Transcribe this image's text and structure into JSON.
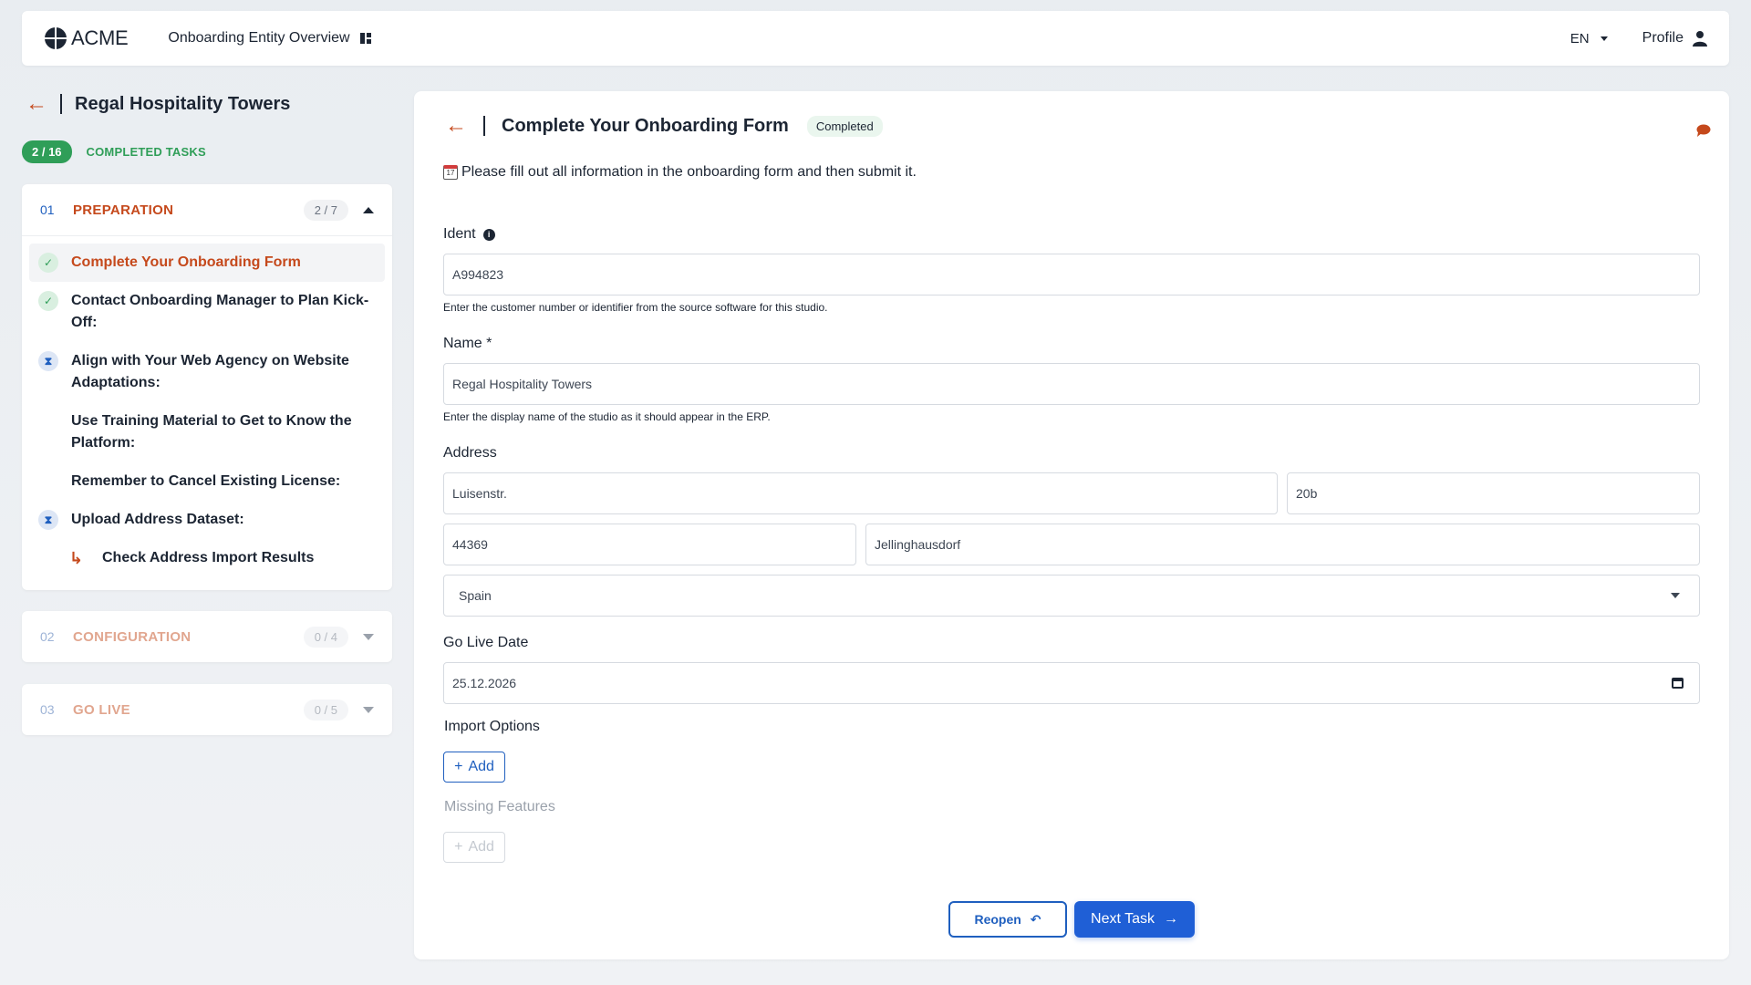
{
  "header": {
    "brand": "ACME",
    "nav_title": "Onboarding Entity Overview",
    "language": "EN",
    "profile_label": "Profile"
  },
  "entity": {
    "name": "Regal Hospitality Towers",
    "completed_count": "2 / 16",
    "completed_label": "COMPLETED TASKS"
  },
  "sections": [
    {
      "number": "01",
      "title": "PREPARATION",
      "count": "2 / 7",
      "tasks": [
        {
          "label": "Complete Your Onboarding Form",
          "status": "done"
        },
        {
          "label": "Contact Onboarding Manager to Plan Kick-Off:",
          "status": "done"
        },
        {
          "label": "Align with Your Web Agency on Website Adaptations:",
          "status": "waiting"
        },
        {
          "label": "Use Training Material to Get to Know the Platform:",
          "status": "none"
        },
        {
          "label": "Remember to Cancel Existing License:",
          "status": "none"
        },
        {
          "label": "Upload Address Dataset:",
          "status": "waiting"
        },
        {
          "label": "Check Address Import Results",
          "status": "sub"
        }
      ]
    },
    {
      "number": "02",
      "title": "CONFIGURATION",
      "count": "0 / 4"
    },
    {
      "number": "03",
      "title": "GO LIVE",
      "count": "0 / 5"
    }
  ],
  "form": {
    "title": "Complete Your Onboarding Form",
    "status_badge": "Completed",
    "instruction": "Please fill out all information in the onboarding form and then submit it.",
    "ident": {
      "label": "Ident",
      "value": "A994823",
      "hint": "Enter the customer number or identifier from the source software for this studio."
    },
    "name": {
      "label": "Name *",
      "value": "Regal Hospitality Towers",
      "hint": "Enter the display name of the studio as it should appear in the ERP."
    },
    "address": {
      "label": "Address",
      "street": "Luisenstr.",
      "number": "20b",
      "zip": "44369",
      "city": "Jellinghausdorf",
      "country": "Spain"
    },
    "go_live": {
      "label": "Go Live Date",
      "value": "25.12.2026"
    },
    "import_options": {
      "label": "Import Options",
      "add_label": "Add"
    },
    "missing_features": {
      "label": "Missing Features",
      "add_label": "Add"
    },
    "buttons": {
      "reopen": "Reopen",
      "next": "Next Task"
    }
  },
  "colors": {
    "accent_orange": "#c5491c",
    "primary_blue": "#1f5fd6",
    "success_green": "#2f9e58"
  }
}
